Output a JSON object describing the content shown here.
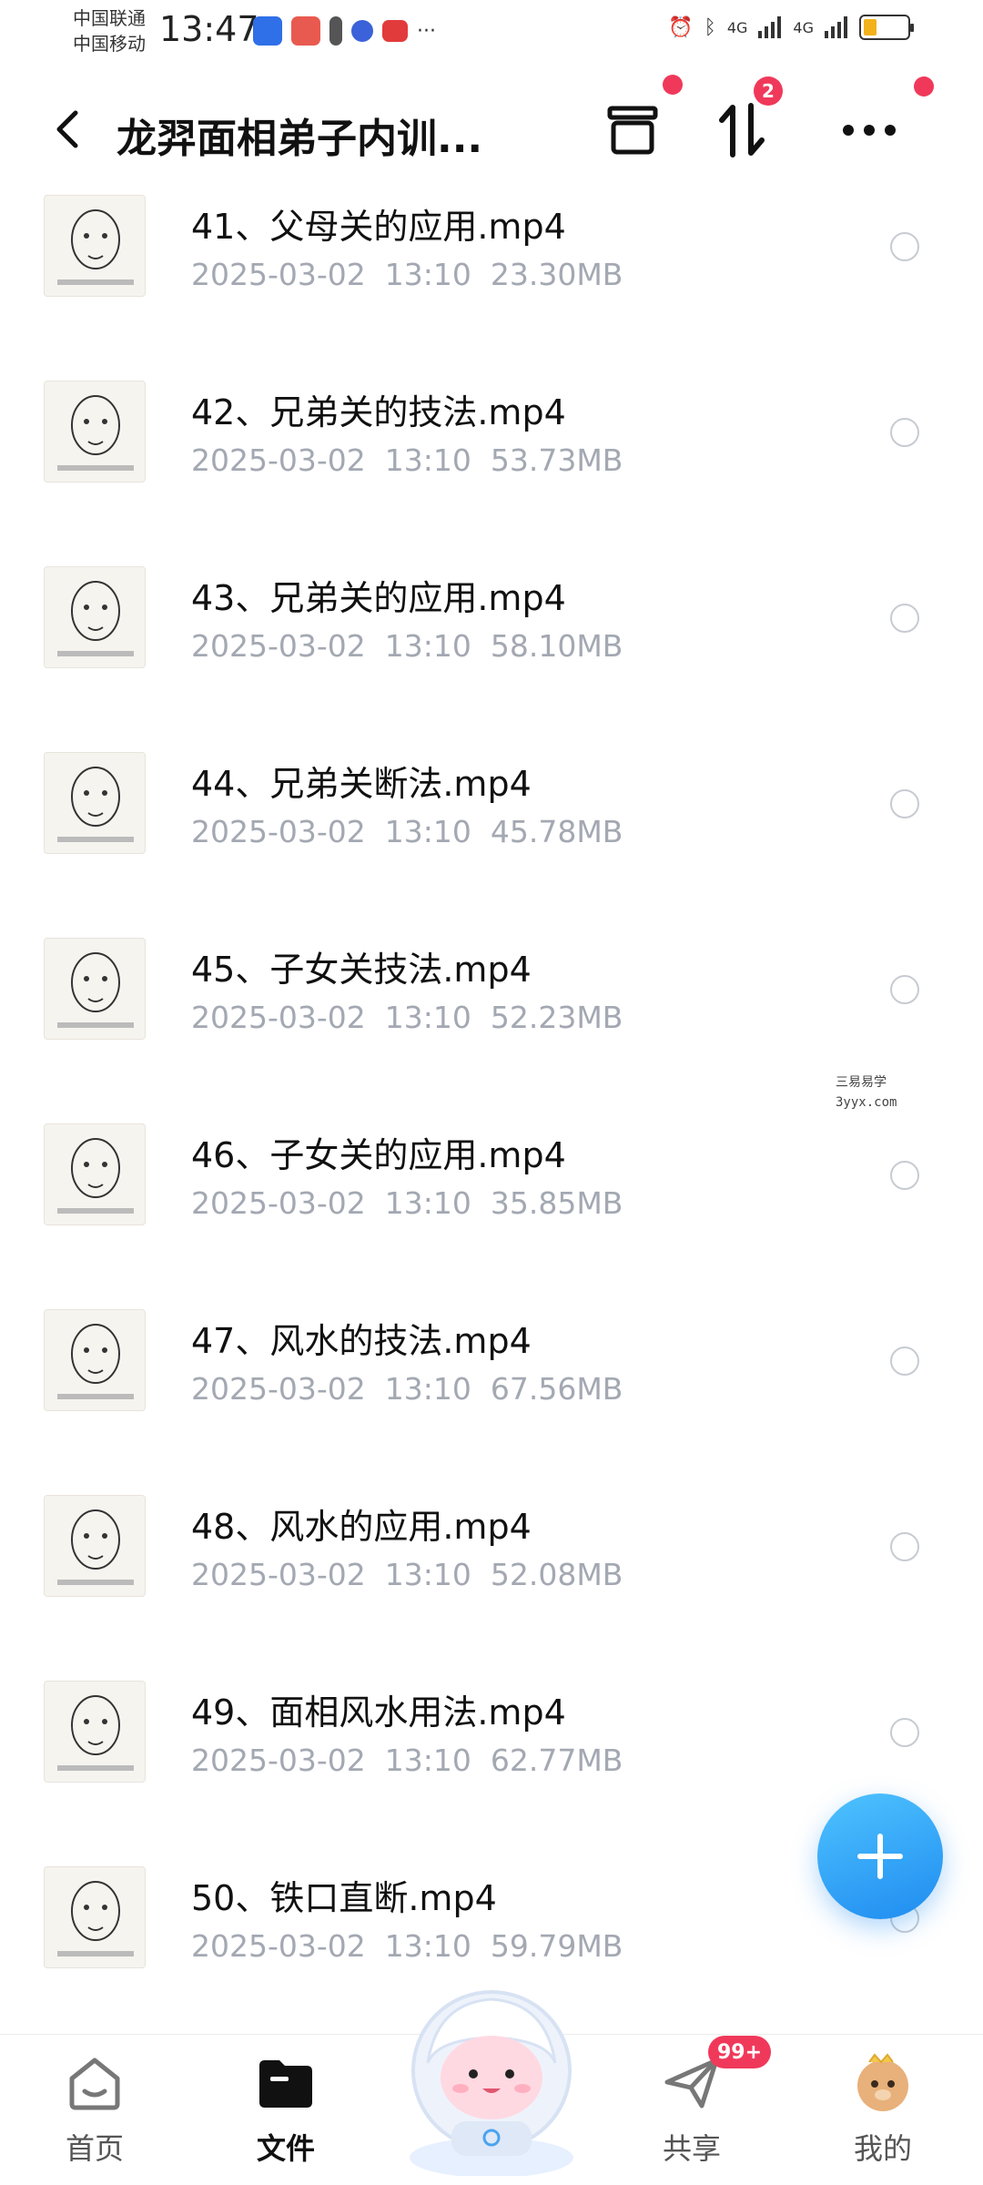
{
  "status_bar": {
    "carrier_1": "中国联通",
    "carrier_2": "中国移动",
    "time": "13:47",
    "network_1": "4G",
    "network_2": "4G"
  },
  "header": {
    "title": "龙羿面相弟子内训...",
    "transfer_badge": "2"
  },
  "files": [
    {
      "name": "41、父母关的应用.mp4",
      "date": "2025-03-02",
      "time": "13:10",
      "size": "23.30MB"
    },
    {
      "name": "42、兄弟关的技法.mp4",
      "date": "2025-03-02",
      "time": "13:10",
      "size": "53.73MB"
    },
    {
      "name": "43、兄弟关的应用.mp4",
      "date": "2025-03-02",
      "time": "13:10",
      "size": "58.10MB"
    },
    {
      "name": "44、兄弟关断法.mp4",
      "date": "2025-03-02",
      "time": "13:10",
      "size": "45.78MB"
    },
    {
      "name": "45、子女关技法.mp4",
      "date": "2025-03-02",
      "time": "13:10",
      "size": "52.23MB"
    },
    {
      "name": "46、子女关的应用.mp4",
      "date": "2025-03-02",
      "time": "13:10",
      "size": "35.85MB"
    },
    {
      "name": "47、风水的技法.mp4",
      "date": "2025-03-02",
      "time": "13:10",
      "size": "67.56MB"
    },
    {
      "name": "48、风水的应用.mp4",
      "date": "2025-03-02",
      "time": "13:10",
      "size": "52.08MB"
    },
    {
      "name": "49、面相风水用法.mp4",
      "date": "2025-03-02",
      "time": "13:10",
      "size": "62.77MB"
    },
    {
      "name": "50、铁口直断.mp4",
      "date": "2025-03-02",
      "time": "13:10",
      "size": "59.79MB"
    }
  ],
  "watermark": {
    "line1": "三易易学",
    "line2": "3yyx.com"
  },
  "bottom_nav": {
    "home": "首页",
    "files": "文件",
    "share": "共享",
    "share_badge": "99+",
    "mine": "我的"
  },
  "colors": {
    "accent": "#1f8cf0",
    "badge": "#f0395a",
    "meta_text": "#a3a8b2"
  }
}
